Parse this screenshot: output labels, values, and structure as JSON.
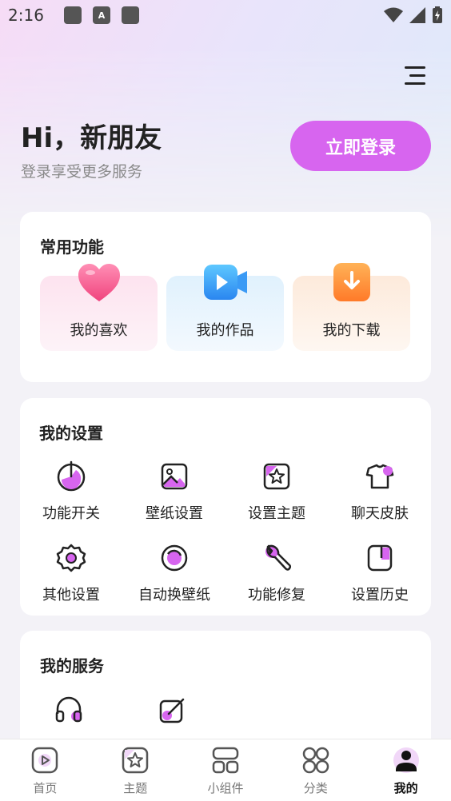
{
  "status_bar": {
    "time": "2:16",
    "notif_icon_letter": "A"
  },
  "header": {
    "greeting": "Hi，新朋友",
    "subtitle": "登录享受更多服务",
    "login_label": "立即登录",
    "accent_color": "#d765ef"
  },
  "common": {
    "title": "常用功能",
    "items": [
      {
        "label": "我的喜欢",
        "icon": "heart-icon"
      },
      {
        "label": "我的作品",
        "icon": "video-icon"
      },
      {
        "label": "我的下载",
        "icon": "download-icon"
      }
    ]
  },
  "settings": {
    "title": "我的设置",
    "items": [
      {
        "label": "功能开关",
        "icon": "power-icon"
      },
      {
        "label": "壁纸设置",
        "icon": "image-icon"
      },
      {
        "label": "设置主题",
        "icon": "theme-icon"
      },
      {
        "label": "聊天皮肤",
        "icon": "shirt-icon"
      },
      {
        "label": "其他设置",
        "icon": "gear-icon"
      },
      {
        "label": "自动换壁纸",
        "icon": "refresh-icon"
      },
      {
        "label": "功能修复",
        "icon": "wrench-icon"
      },
      {
        "label": "设置历史",
        "icon": "history-icon"
      }
    ]
  },
  "services": {
    "title": "我的服务",
    "items": [
      {
        "icon": "headset-icon"
      },
      {
        "icon": "edit-icon"
      }
    ]
  },
  "tabbar": {
    "items": [
      {
        "label": "首页",
        "icon": "home-icon",
        "active": false
      },
      {
        "label": "主题",
        "icon": "theme-tab-icon",
        "active": false
      },
      {
        "label": "小组件",
        "icon": "widget-icon",
        "active": false
      },
      {
        "label": "分类",
        "icon": "category-icon",
        "active": false
      },
      {
        "label": "我的",
        "icon": "profile-icon",
        "active": true
      }
    ]
  }
}
